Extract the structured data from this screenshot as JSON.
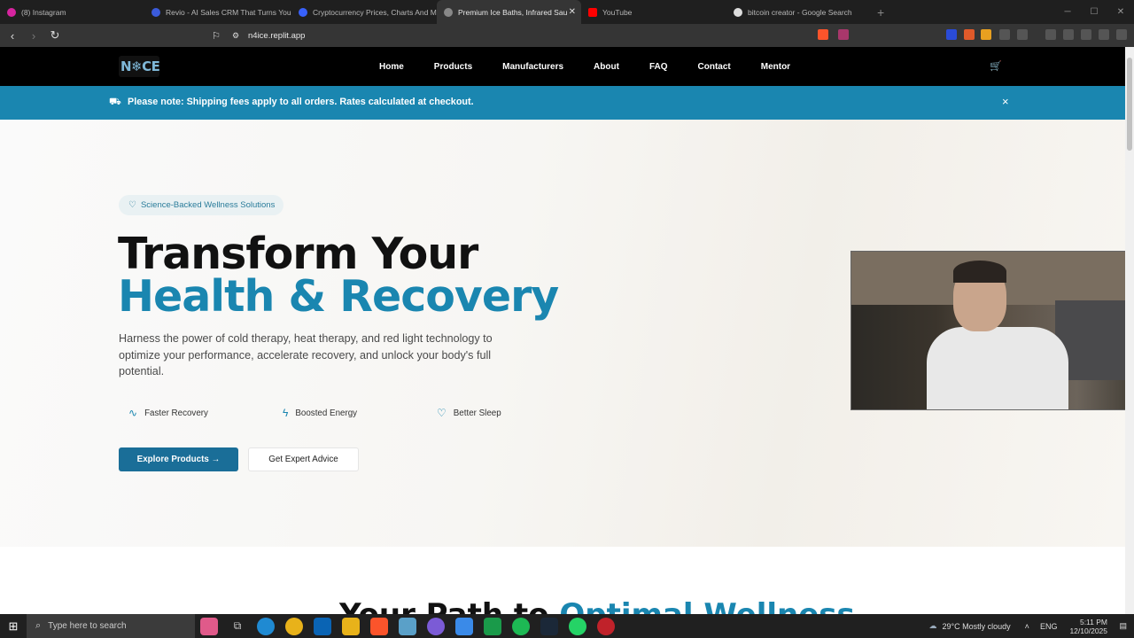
{
  "browser": {
    "tabs": [
      {
        "title": "(8) Instagram",
        "color": "#d6249f"
      },
      {
        "title": "Revio - AI Sales CRM That Turns You",
        "color": "#3b5bdb"
      },
      {
        "title": "Cryptocurrency Prices, Charts And M",
        "color": "#3861fb"
      },
      {
        "title": "Premium Ice Baths, Infrared Sau",
        "color": "#888888",
        "active": true
      },
      {
        "title": "YouTube",
        "color": "#ff0000"
      },
      {
        "title": "bitcoin creator - Google Search",
        "color": "#dddddd"
      }
    ],
    "new_tab": "+",
    "url": "n4ice.replit.app"
  },
  "site": {
    "logo": "N❄CE",
    "nav": [
      "Home",
      "Products",
      "Manufacturers",
      "About",
      "FAQ",
      "Contact",
      "Mentor"
    ],
    "cart_icon": "cart-icon",
    "banner": {
      "icon": "truck-icon",
      "message": "Please note: Shipping fees apply to all orders. Rates calculated at checkout.",
      "close": "×"
    },
    "hero": {
      "pill": "Science-Backed Wellness Solutions",
      "title_line1": "Transform Your",
      "title_line2": "Health & Recovery",
      "subtitle": "Harness the power of cold therapy, heat therapy, and red light technology to optimize your performance, accelerate recovery, and unlock your body's full potential.",
      "features": [
        "Faster Recovery",
        "Boosted Energy",
        "Better Sleep"
      ],
      "cta_primary": "Explore Products →",
      "cta_secondary": "Get Expert Advice"
    },
    "section2": {
      "title_part1": "Your Path to ",
      "title_part2": "Optimal Wellness"
    }
  },
  "taskbar": {
    "search_placeholder": "Type here to search",
    "weather": "29°C  Mostly cloudy",
    "lang": "ENG",
    "time": "5:11 PM",
    "date": "12/10/2025"
  },
  "colors": {
    "accent": "#1a86b0",
    "nav_bg": "#000000",
    "banner_bg": "#1a86b0"
  }
}
